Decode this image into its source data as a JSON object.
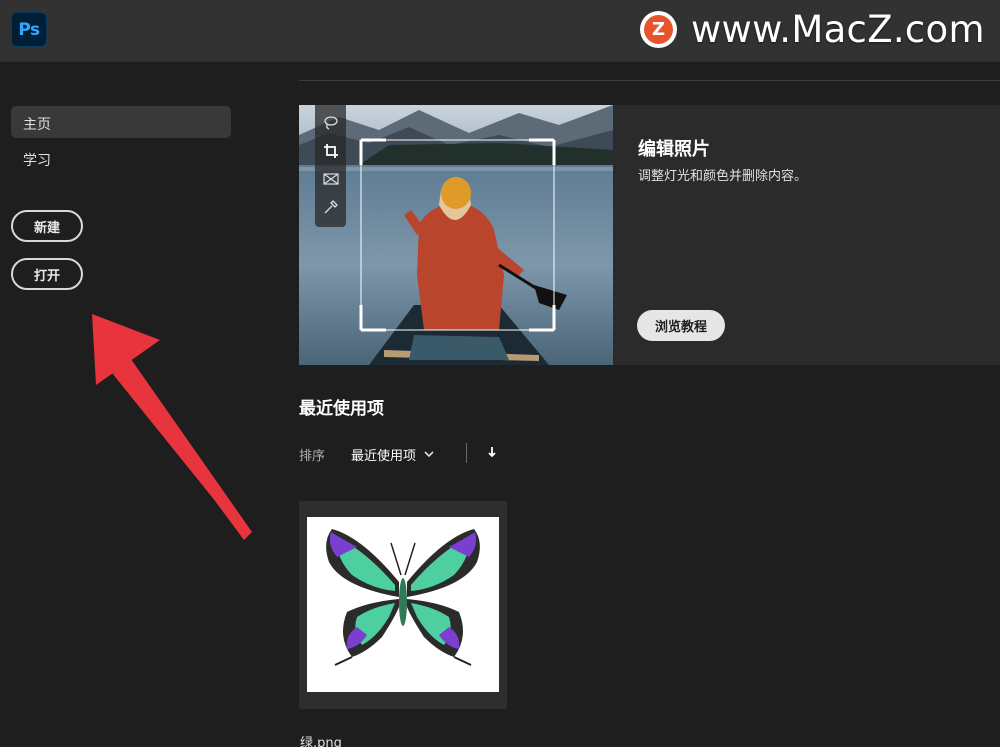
{
  "app": {
    "logo_text": "Ps"
  },
  "watermark": {
    "badge_letter": "Z",
    "text": "www.MacZ.com"
  },
  "sidebar": {
    "items": [
      {
        "label": "主页",
        "active": true
      },
      {
        "label": "学习",
        "active": false
      }
    ],
    "new_button": "新建",
    "open_button": "打开"
  },
  "hero": {
    "title": "编辑照片",
    "description": "调整灯光和颜色并删除内容。",
    "button": "浏览教程",
    "tools": [
      "lasso-icon",
      "crop-icon",
      "frame-icon",
      "eyedropper-icon"
    ]
  },
  "recent": {
    "title": "最近使用项",
    "sort_label": "排序",
    "sort_value": "最近使用项",
    "files": [
      {
        "name": "绿.png"
      }
    ]
  },
  "colors": {
    "background": "#1e1e1e",
    "topbar": "#323232",
    "ps_blue": "#31a8ff",
    "annotation_arrow": "#e8343c"
  }
}
